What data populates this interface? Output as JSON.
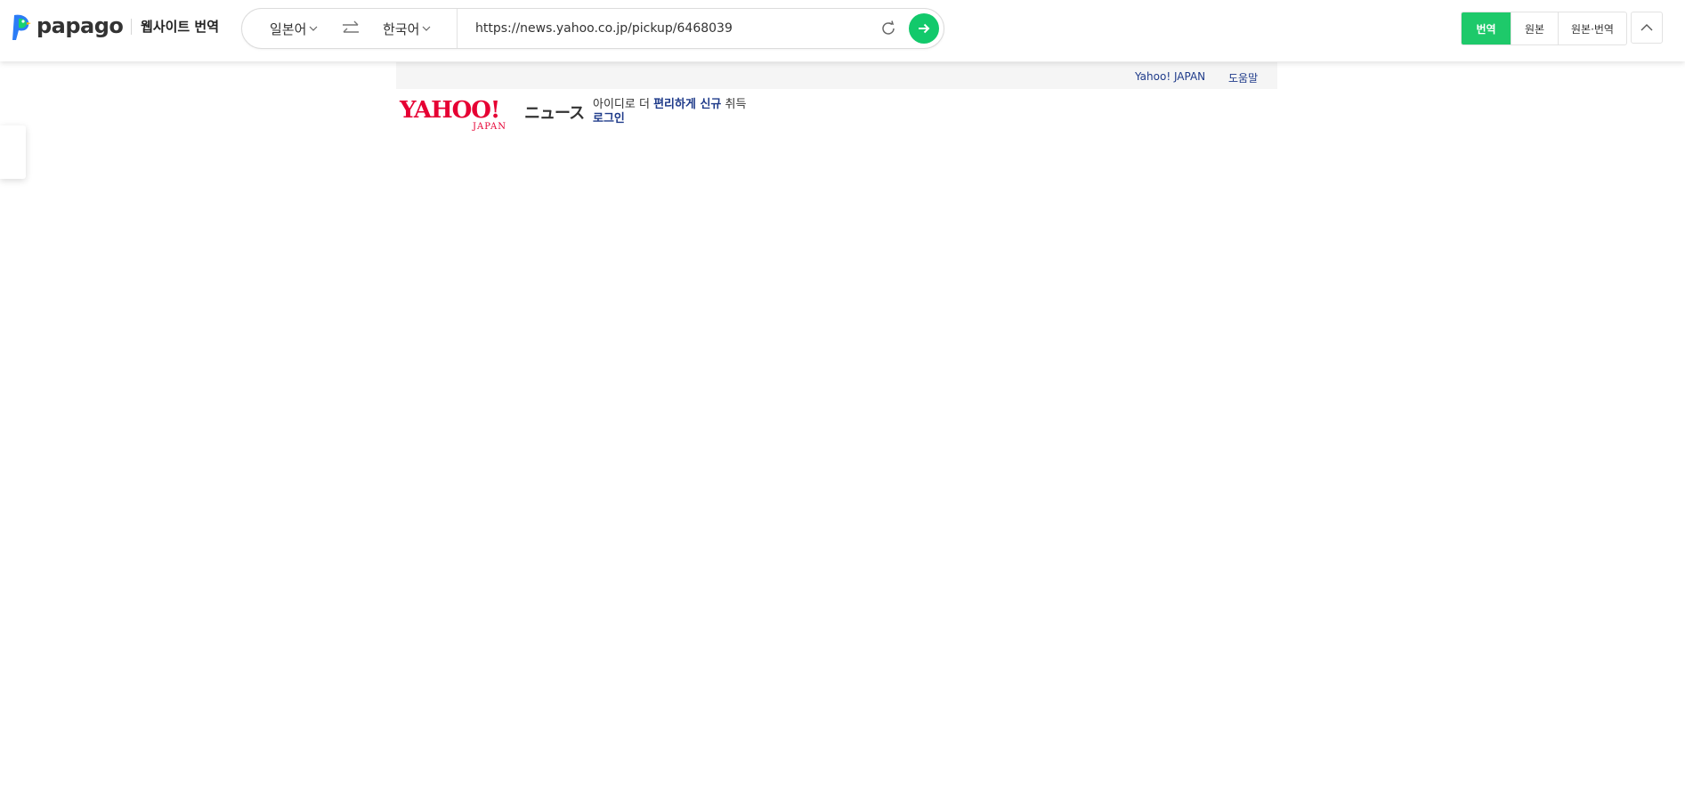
{
  "app": {
    "logo_text": "papago",
    "service_title": "웹사이트 번역"
  },
  "translator": {
    "source_language": "일본어",
    "target_language": "한국어",
    "url_value": "https://news.yahoo.co.jp/pickup/6468039",
    "modes": [
      {
        "label": "번역",
        "active": true
      },
      {
        "label": "원본",
        "active": false
      },
      {
        "label": "원본·번역",
        "active": false
      }
    ]
  },
  "colors": {
    "papago_green": "#1ec96a",
    "yahoo_red": "#e60033",
    "link_blue": "#1f3b8a"
  },
  "icons": [
    "papago-logo-icon",
    "chevron-down-icon",
    "swap-icon",
    "refresh-icon",
    "arrow-right-icon",
    "chevron-up-icon"
  ],
  "page": {
    "top_links": {
      "yahoo_japan": "Yahoo! JAPAN",
      "help": "도움말"
    },
    "logo": {
      "main": "YAHOO!",
      "sub": "JAPAN"
    },
    "news_label": "ニュース",
    "promo": {
      "prefix": "아이디로 더 ",
      "link": "편리하게 신규",
      "suffix": " 취득"
    },
    "login_label": "로그인"
  }
}
